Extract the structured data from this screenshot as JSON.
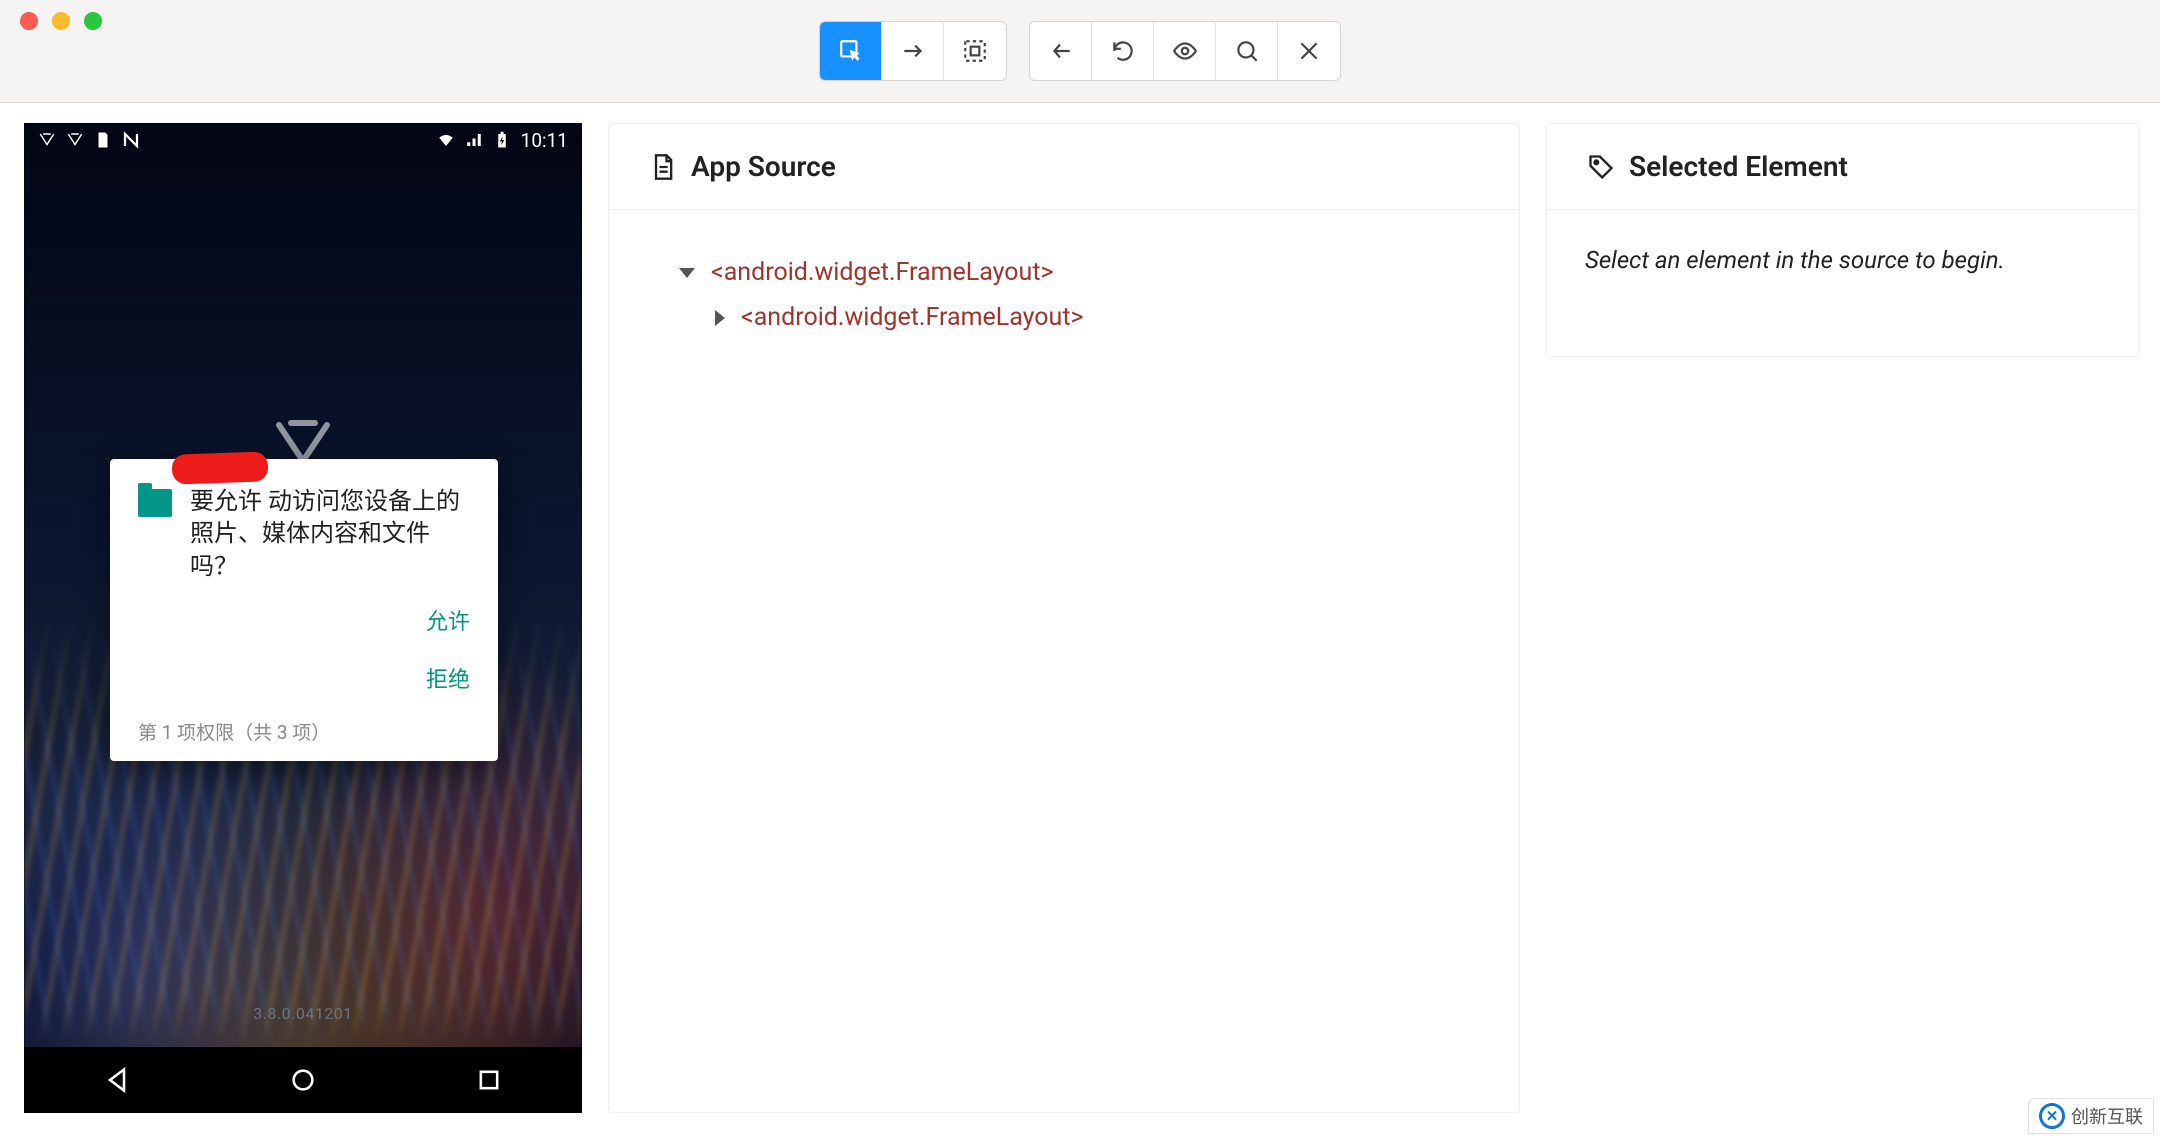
{
  "toolbar": {
    "buttons_group1": [
      "inspect",
      "swipe",
      "bounds"
    ],
    "buttons_group2": [
      "back",
      "refresh",
      "eye",
      "search",
      "close"
    ],
    "active": "inspect"
  },
  "device": {
    "status_time": "10:11",
    "dialog": {
      "text": "要允许        动访问您设备上的照片、媒体内容和文件吗？",
      "allow": "允许",
      "deny": "拒绝",
      "counter": "第 1 项权限（共 3 项）"
    },
    "version": "3.8.0.041201"
  },
  "source": {
    "title": "App Source",
    "tree": {
      "root": "<android.widget.FrameLayout>",
      "child": "<android.widget.FrameLayout>"
    }
  },
  "selected": {
    "title": "Selected Element",
    "empty_hint": "Select an element in the source to begin."
  },
  "watermark": "创新互联"
}
